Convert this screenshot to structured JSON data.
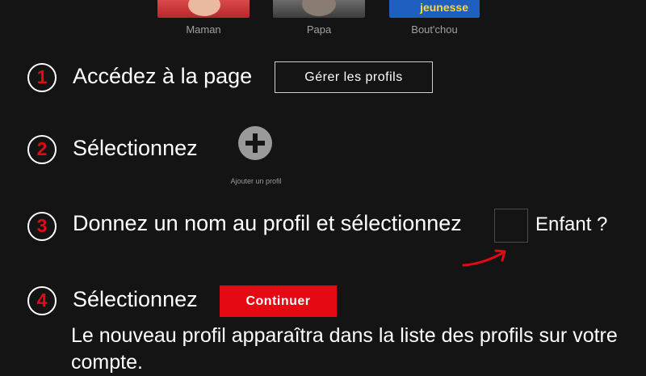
{
  "profiles": [
    {
      "name": "Maman"
    },
    {
      "name": "Papa"
    },
    {
      "name": "Bout'chou",
      "thumb_text": "jeunesse"
    }
  ],
  "steps": [
    {
      "number": "1",
      "text": "Accédez à la page",
      "button_label": "Gérer les profils"
    },
    {
      "number": "2",
      "text": "Sélectionnez",
      "add_profile_label": "Ajouter un profil"
    },
    {
      "number": "3",
      "text": "Donnez un nom au profil et sélectionnez",
      "checkbox_label": "Enfant ?"
    },
    {
      "number": "4",
      "text": "Sélectionnez",
      "button_label": "Continuer"
    }
  ],
  "info_text": "Le nouveau profil apparaîtra dans la liste des profils sur votre compte.",
  "colors": {
    "background": "#141414",
    "accent": "#e50914",
    "muted_text": "#a0a0a0"
  },
  "icons": {
    "add_profile": "plus-circle-icon",
    "annotation": "curved-arrow-icon"
  }
}
